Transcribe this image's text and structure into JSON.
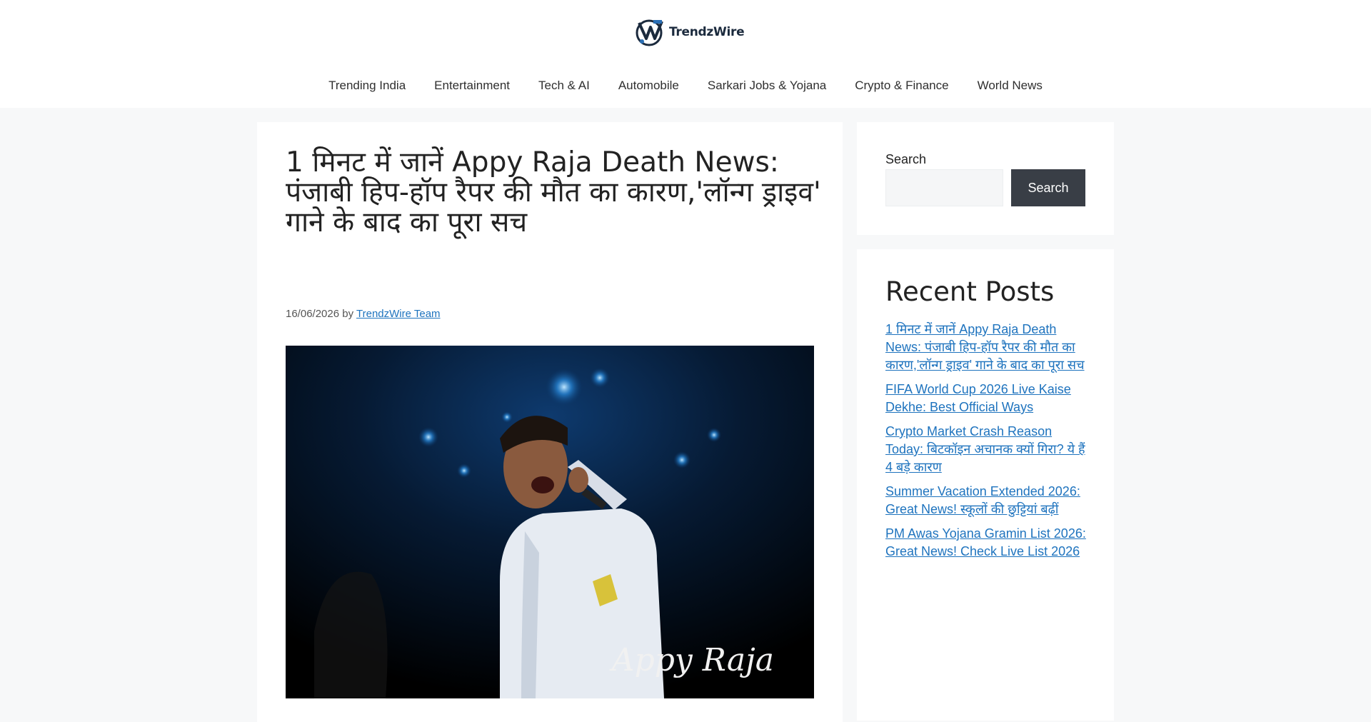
{
  "site": {
    "name": "TrendzWire",
    "logo_icon": "trendzwire-logo-icon"
  },
  "nav": {
    "items": [
      {
        "label": "Trending India"
      },
      {
        "label": "Entertainment"
      },
      {
        "label": "Tech & AI"
      },
      {
        "label": "Automobile"
      },
      {
        "label": "Sarkari Jobs & Yojana"
      },
      {
        "label": "Crypto & Finance"
      },
      {
        "label": "World News"
      }
    ]
  },
  "article": {
    "title": "1 मिनट में जानें Appy Raja Death News: पंजाबी हिप-हॉप रैपर की मौत का कारण,'लॉन्ग ड्राइव' गाने के बाद का पूरा सच",
    "date": "16/06/2026",
    "by": "by",
    "author": "TrendzWire Team",
    "image_caption": "Appy Raja"
  },
  "sidebar": {
    "search_label": "Search",
    "search_button": "Search",
    "search_value": "",
    "recent_heading": "Recent Posts",
    "recent_posts": [
      {
        "title": "1 मिनट में जानें Appy Raja Death News: पंजाबी हिप-हॉप रैपर की मौत का कारण,'लॉन्ग ड्राइव' गाने के बाद का पूरा सच"
      },
      {
        "title": "FIFA World Cup 2026 Live Kaise Dekhe: Best Official Ways"
      },
      {
        "title": "Crypto Market Crash Reason Today: बिटकॉइन अचानक क्यों गिरा? ये हैं 4 बड़े कारण"
      },
      {
        "title": "Summer Vacation Extended 2026: Great News! स्कूलों की छुट्टियां बढ़ीं"
      },
      {
        "title": "PM Awas Yojana Gramin List 2026: Great News! Check Live List 2026"
      }
    ]
  },
  "colors": {
    "link": "#1e73be",
    "button_bg": "#393e46",
    "page_bg": "#f7f8f9"
  }
}
